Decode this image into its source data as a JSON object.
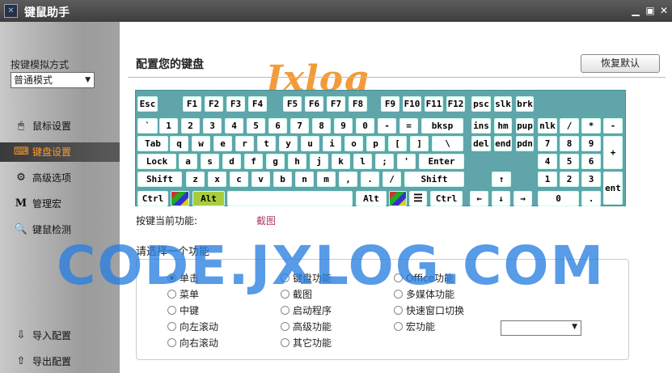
{
  "window": {
    "title": "键鼠助手",
    "app_icon": "app-logo-icon"
  },
  "sidebar": {
    "mode_label": "按键模拟方式",
    "mode_value": "普通模式",
    "items": [
      {
        "label": "鼠标设置",
        "icon": "mouse-icon"
      },
      {
        "label": "键盘设置",
        "icon": "keyboard-icon"
      },
      {
        "label": "高级选项",
        "icon": "gear-icon"
      },
      {
        "label": "管理宏",
        "icon": "macro-icon"
      },
      {
        "label": "键鼠检测",
        "icon": "magnifier-icon"
      },
      {
        "label": "导入配置",
        "icon": "import-icon"
      },
      {
        "label": "导出配置",
        "icon": "export-icon"
      }
    ],
    "active_item": "键盘设置"
  },
  "main": {
    "title": "配置您的键盘",
    "restore_label": "恢复默认",
    "logo_text": "Jxlog",
    "func_label": "按键当前功能:",
    "func_value": "截图",
    "choose_label": "请选择一个功能",
    "options": [
      {
        "label": "单击",
        "selected": true
      },
      {
        "label": "菜单",
        "selected": false
      },
      {
        "label": "中键",
        "selected": false
      },
      {
        "label": "向左滚动",
        "selected": false
      },
      {
        "label": "向右滚动",
        "selected": false
      },
      {
        "label": "键盘功能",
        "selected": false
      },
      {
        "label": "截图",
        "selected": false
      },
      {
        "label": "启动程序",
        "selected": false
      },
      {
        "label": "高级功能",
        "selected": false
      },
      {
        "label": "其它功能",
        "selected": false
      },
      {
        "label": "Office功能",
        "selected": false
      },
      {
        "label": "多媒体功能",
        "selected": false
      },
      {
        "label": "快速窗口切换",
        "selected": false
      },
      {
        "label": "宏功能",
        "selected": false
      }
    ],
    "watermark": "CODE.JXLOG.COM"
  },
  "keyboard": {
    "rows": [
      [
        "Esc",
        "F1",
        "F2",
        "F3",
        "F4",
        "F5",
        "F6",
        "F7",
        "F8",
        "F9",
        "F10",
        "F11",
        "F12",
        "psc",
        "slk",
        "brk"
      ],
      [
        "`",
        "1",
        "2",
        "3",
        "4",
        "5",
        "6",
        "7",
        "8",
        "9",
        "0",
        "-",
        "=",
        "bksp",
        "ins",
        "hm",
        "pup",
        "nlk",
        "/",
        "*",
        "-"
      ],
      [
        "Tab",
        "q",
        "w",
        "e",
        "r",
        "t",
        "y",
        "u",
        "i",
        "o",
        "p",
        "[",
        "]",
        "\\",
        "del",
        "end",
        "pdn",
        "7",
        "8",
        "9",
        "+"
      ],
      [
        "Lock",
        "a",
        "s",
        "d",
        "f",
        "g",
        "h",
        "j",
        "k",
        "l",
        ";",
        "'",
        "Enter",
        "4",
        "5",
        "6"
      ],
      [
        "Shift",
        "z",
        "x",
        "c",
        "v",
        "b",
        "n",
        "m",
        ",",
        ".",
        "/",
        "Shift",
        "↑",
        "1",
        "2",
        "3",
        "ent"
      ],
      [
        "Ctrl",
        "Win",
        "Alt",
        "",
        "Alt",
        "Win",
        "Menu",
        "Ctrl",
        "←",
        "↓",
        "→",
        "0",
        "."
      ]
    ]
  },
  "colors": {
    "keyboard_bg": "#5fa5aa",
    "active_nav": "#ff9a2a",
    "func_value": "#b03a6a"
  }
}
